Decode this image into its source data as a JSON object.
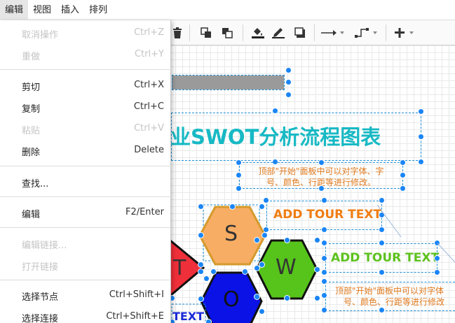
{
  "menubar": {
    "items": [
      "编辑",
      "视图",
      "插入",
      "排列"
    ],
    "active_index": 0
  },
  "toolbar": {
    "icons": [
      "delete-icon",
      "to-front-icon",
      "to-back-icon",
      "fill-color-icon",
      "line-color-icon",
      "shadow-icon",
      "connection-arrow-icon",
      "waypoints-icon",
      "insert-plus-icon"
    ]
  },
  "dropdown": {
    "items": [
      {
        "label": "取消操作",
        "shortcut": "Ctrl+Z",
        "disabled": true
      },
      {
        "label": "重做",
        "shortcut": "Ctrl+Y",
        "disabled": true
      },
      {
        "label": "剪切",
        "shortcut": "Ctrl+X",
        "disabled": false
      },
      {
        "label": "复制",
        "shortcut": "Ctrl+C",
        "disabled": false
      },
      {
        "label": "粘贴",
        "shortcut": "Ctrl+V",
        "disabled": true
      },
      {
        "label": "删除",
        "shortcut": "Delete",
        "disabled": false
      },
      {
        "label": "查找...",
        "shortcut": "",
        "disabled": false
      },
      {
        "label": "编辑",
        "shortcut": "F2/Enter",
        "disabled": false
      },
      {
        "label": "编辑链接...",
        "shortcut": "",
        "disabled": true
      },
      {
        "label": "打开链接",
        "shortcut": "",
        "disabled": true
      },
      {
        "label": "选择节点",
        "shortcut": "Ctrl+Shift+I",
        "disabled": false
      },
      {
        "label": "选择连接",
        "shortcut": "Ctrl+Shift+E",
        "disabled": false
      }
    ]
  },
  "canvas": {
    "title": "业SWOT分析流程图表",
    "note1_line1": "顶部\"开始\"面板中可以对字体、字",
    "note1_line2": "号、颜色、行距等进行修改。",
    "note2_line1": "顶部\"开始\"面板中可以对字体",
    "note2_line2": "号、颜色、行距等进行修改",
    "tour_text_1": "ADD TOUR TEXT",
    "tour_text_2": "ADD TOUR TEXT",
    "tour_text_3": "TEXT",
    "hex_s": "S",
    "hex_t": "T",
    "hex_w": "W",
    "hex_o": "O"
  },
  "colors": {
    "title": "#17b9c4",
    "hex_s_fill": "#f7ad63",
    "hex_s_stroke": "#d69a2c",
    "hex_t_fill": "#ef2f3a",
    "hex_w_fill": "#56c41a",
    "hex_o_fill": "#0a12e6",
    "tour_1": "#f07d12",
    "tour_2": "#5dc21e",
    "tour_3": "#1a2ad6",
    "selection": "#1a85f5"
  }
}
